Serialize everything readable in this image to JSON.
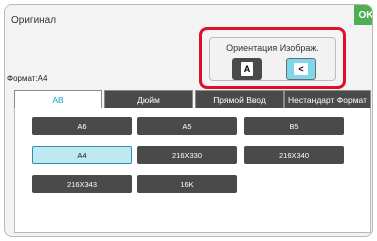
{
  "header": {
    "title": "Оригинал",
    "ok_label": "OK",
    "format_label": "Формат:А4"
  },
  "orientation": {
    "title": "Ориентация Изображ.",
    "portrait_glyph": "A",
    "landscape_glyph": "<",
    "selected": "landscape"
  },
  "tabs": [
    {
      "label": "AB",
      "active": true
    },
    {
      "label": "Дюйм",
      "active": false
    },
    {
      "label": "Прямой Ввод",
      "active": false
    },
    {
      "label": "Нестандарт Формат",
      "active": false
    }
  ],
  "sizes": [
    {
      "label": "A6",
      "selected": false
    },
    {
      "label": "A5",
      "selected": false
    },
    {
      "label": "B5",
      "selected": false
    },
    {
      "label": "A4",
      "selected": true
    },
    {
      "label": "216X330",
      "selected": false
    },
    {
      "label": "216X340",
      "selected": false
    },
    {
      "label": "216X343",
      "selected": false
    },
    {
      "label": "16K",
      "selected": false
    }
  ],
  "colors": {
    "highlight": "#e0102a",
    "ok": "#4caf50",
    "selected": "#bfe9f2",
    "button_dark": "#4a4a4a",
    "accent": "#1aa0c8"
  }
}
